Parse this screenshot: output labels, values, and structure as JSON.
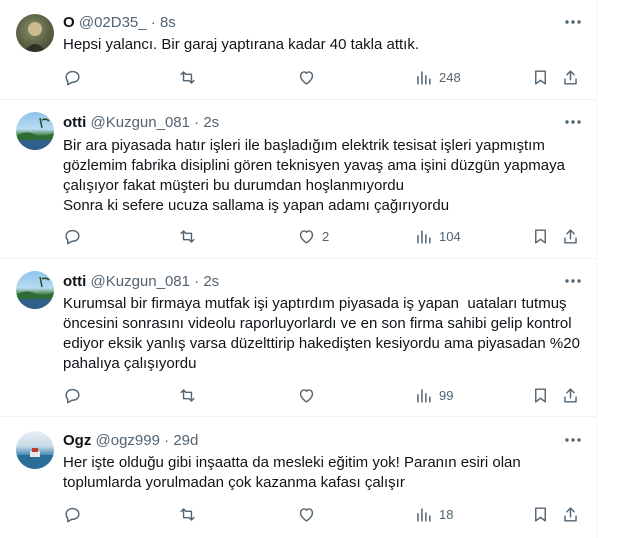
{
  "colors": {
    "text": "#0f1419",
    "muted": "#536471",
    "divider": "#eff3f4",
    "background": "#ffffff"
  },
  "tweets": [
    {
      "name": "O",
      "handle": "@02D35_",
      "separator": "·",
      "time": "8s",
      "text": "Hepsi yalancı. Bir garaj yaptırana kadar 40 takla attık.",
      "replies": "",
      "retweets": "",
      "likes": "",
      "views": "248"
    },
    {
      "name": "otti",
      "handle": "@Kuzgun_081",
      "separator": "·",
      "time": "2s",
      "text": "Bir ara piyasada hatır işleri ile başladığım elektrik tesisat işleri yapmıştım gözlemim fabrika disiplini gören teknisyen yavaş ama işini düzgün yapmaya çalışıyor fakat müşteri bu durumdan hoşlanmıyordu\nSonra ki sefere ucuza sallama iş yapan adamı çağırıyordu",
      "replies": "",
      "retweets": "",
      "likes": "2",
      "views": "104"
    },
    {
      "name": "otti",
      "handle": "@Kuzgun_081",
      "separator": "·",
      "time": "2s",
      "text": "Kurumsal bir firmaya mutfak işi yaptırdım piyasada iş yapan  uataları tutmuş öncesini sonrasını videolu raporluyorlardı ve en son firma sahibi gelip kontrol ediyor eksik yanlış varsa düzelttirip hakedişten kesiyordu ama piyasadan %20 pahalıya çalışıyordu",
      "replies": "",
      "retweets": "",
      "likes": "",
      "views": "99"
    },
    {
      "name": "Ogz",
      "handle": "@ogz999",
      "separator": "·",
      "time": "29d",
      "text": "Her işte olduğu gibi inşaatta da mesleki eğitim yok! Paranın esiri olan toplumlarda yorulmadan çok kazanma kafası çalışır",
      "replies": "",
      "retweets": "",
      "likes": "",
      "views": "18"
    }
  ]
}
